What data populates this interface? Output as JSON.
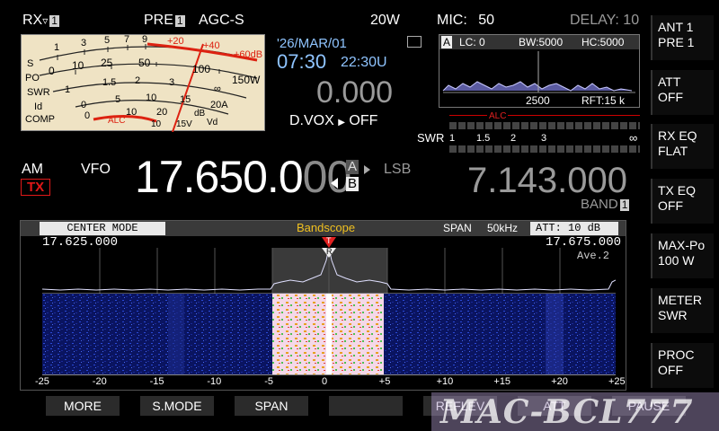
{
  "topbar": {
    "rx_label": "RX",
    "rx_num": "1",
    "pre_label": "PRE",
    "pre_num": "1",
    "agc": "AGC-S",
    "power": "20W",
    "mic_label": "MIC:",
    "mic_value": "50",
    "delay": "DELAY: 10"
  },
  "meter": {
    "scale_labels": [
      "S",
      "PO",
      "SWR",
      "Id",
      "COMP"
    ],
    "s_ticks": [
      "1",
      "3",
      "5",
      "7",
      "9",
      "+20",
      "+40",
      "+60dB"
    ],
    "po_ticks": [
      "0",
      "10",
      "25",
      "50",
      "100",
      "150W"
    ],
    "swr_ticks": [
      "1",
      "1.5",
      "2",
      "3",
      "∞"
    ],
    "id_ticks": [
      "0",
      "5",
      "10",
      "15",
      "20A"
    ],
    "comp_ticks": [
      "0",
      "10",
      "20",
      "dB"
    ],
    "alc_label": "ALC",
    "vd_ticks": [
      "10",
      "15V",
      "Vd"
    ]
  },
  "clock": {
    "date": "'26/MAR/01",
    "local_time": "07:30",
    "utc_time": "22:30U",
    "rit": "0.000",
    "dvox_label": "D.VOX",
    "dvox_value": "OFF"
  },
  "mini_scope": {
    "vfo": "A",
    "lc": "LC:  0",
    "bw": "BW:5000",
    "hc": "HC:5000",
    "center_freq": "2500",
    "rft": "RFT:15 k"
  },
  "tx_meter": {
    "alc_label": "ALC",
    "swr_label": "SWR",
    "swr_ticks": [
      "1",
      "1.5",
      "2",
      "3",
      "∞"
    ]
  },
  "main": {
    "mode": "AM",
    "tx_badge": "TX",
    "vfo_label": "VFO",
    "freq_main": "17.650.0",
    "freq_dim": "00",
    "vfo_a": "A",
    "vfo_b": "B",
    "sideband": "LSB",
    "sub_freq": "7.143.000",
    "band_label": "BAND",
    "band_num": "1"
  },
  "scope": {
    "mode": "CENTER MODE",
    "title": "Bandscope",
    "span_label": "SPAN",
    "span_value": "50kHz",
    "att": "ATT: 10 dB",
    "freq_low": "17.625.000",
    "freq_high": "17.675.000",
    "average": "Ave.2",
    "tx_marker": "T",
    "rx_marker": "R",
    "axis_ticks": [
      "-25",
      "-20",
      "-15",
      "-10",
      "-5",
      "0",
      "+5",
      "+10",
      "+15",
      "+20",
      "+25"
    ]
  },
  "softkeys": [
    {
      "line1": "ANT 1",
      "line2": "PRE 1"
    },
    {
      "line1": "ATT",
      "line2": "OFF"
    },
    {
      "line1": "RX EQ",
      "line2": "FLAT"
    },
    {
      "line1": "TX EQ",
      "line2": "OFF"
    },
    {
      "line1": "MAX-Po",
      "line2": "100 W"
    },
    {
      "line1": "METER",
      "line2": "SWR"
    },
    {
      "line1": "PROC",
      "line2": "OFF"
    }
  ],
  "bottom_keys": [
    "MORE",
    "S.MODE",
    "SPAN",
    "",
    "REFLEV",
    "ATT",
    "PAUSE"
  ],
  "watermark": "MAC-BCL777",
  "colors": {
    "accent_red": "#e01818",
    "meter_bg": "#efe3c4",
    "scope_header": "#3a3a3a",
    "waterfall_bg": "#0a1460"
  }
}
